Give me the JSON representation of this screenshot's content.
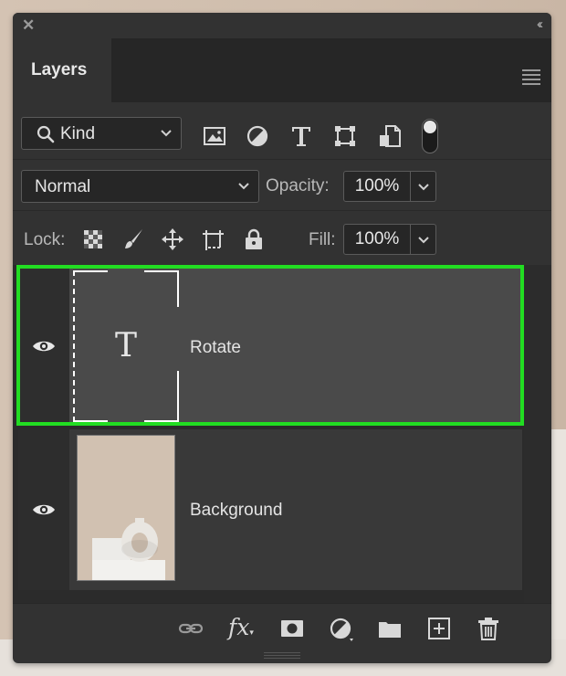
{
  "panel": {
    "close_glyph": "✕",
    "collapse_glyph": "‹‹"
  },
  "tabs": {
    "active": "Layers",
    "menu_icon": "hamburger-icon"
  },
  "filter": {
    "kind_label": "Kind",
    "filter_icons": [
      "image-filter-icon",
      "adjustment-filter-icon",
      "type-filter-icon",
      "shape-filter-icon",
      "smart-object-filter-icon"
    ],
    "toggle_on": true
  },
  "blend": {
    "mode": "Normal",
    "opacity_label": "Opacity:",
    "opacity_value": "100%"
  },
  "lock": {
    "label": "Lock:",
    "fill_label": "Fill:",
    "fill_value": "100%",
    "icons": [
      "lock-transparent-icon",
      "lock-image-icon",
      "lock-position-icon",
      "lock-artboard-icon",
      "lock-all-icon"
    ]
  },
  "layers": [
    {
      "name": "Rotate",
      "type": "text",
      "visible": true,
      "selected": true,
      "thumb_glyph": "T"
    },
    {
      "name": "Background",
      "type": "image",
      "visible": true,
      "selected": false
    }
  ],
  "footer": {
    "fx_label": "fx",
    "icons": [
      "link-layers-icon",
      "fx-icon",
      "add-mask-icon",
      "adjustment-layer-icon",
      "new-group-icon",
      "new-layer-icon",
      "delete-icon"
    ]
  },
  "colors": {
    "panel": "#323232",
    "selected_row": "#4a4a4a",
    "highlight": "#22dd22",
    "text": "#e4e4e4"
  }
}
